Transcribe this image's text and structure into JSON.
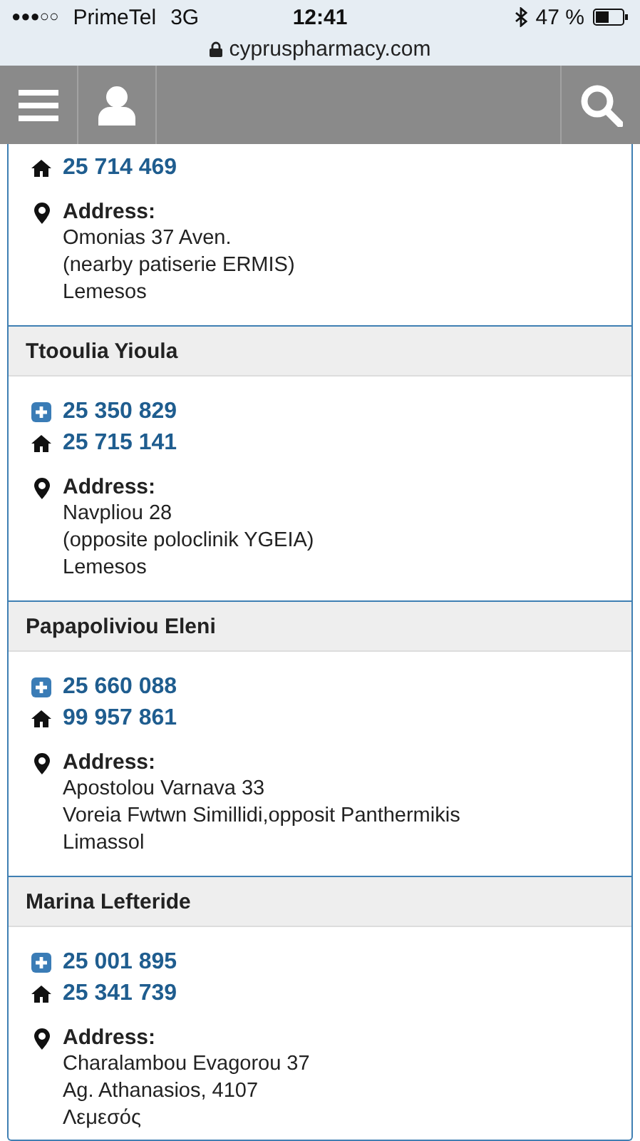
{
  "status_bar": {
    "signal": "●●●○○",
    "carrier": "PrimeTel",
    "network": "3G",
    "time": "12:41",
    "battery": "47 %"
  },
  "address_bar": {
    "url": "cypruspharmacy.com"
  },
  "pharmacies": [
    {
      "phones": [
        {
          "kind": "home",
          "number": "25 714 469"
        }
      ],
      "address_label": "Address:",
      "address_lines": [
        "Omonias 37 Aven.",
        "(nearby patiserie ERMIS)",
        "Lemesos"
      ]
    },
    {
      "name": "Ttooulia Yioula",
      "phones": [
        {
          "kind": "pharmacy",
          "number": "25 350 829"
        },
        {
          "kind": "home",
          "number": "25 715 141"
        }
      ],
      "address_label": "Address:",
      "address_lines": [
        "Navpliou 28",
        "(opposite poloclinik YGEIA)",
        "Lemesos"
      ]
    },
    {
      "name": "Papapoliviou Eleni",
      "phones": [
        {
          "kind": "pharmacy",
          "number": "25 660 088"
        },
        {
          "kind": "home",
          "number": "99 957 861"
        }
      ],
      "address_label": "Address:",
      "address_lines": [
        "Apostolou Varnava 33",
        "Voreia Fwtwn Simillidi,opposit Panthermikis",
        "Limassol"
      ]
    },
    {
      "name": "Marina Lefteride",
      "phones": [
        {
          "kind": "pharmacy",
          "number": "25 001 895"
        },
        {
          "kind": "home",
          "number": "25 341 739"
        }
      ],
      "address_label": "Address:",
      "address_lines": [
        "Charalambou Evagorou 37",
        "Ag. Athanasios, 4107",
        "Λεμεσός"
      ]
    }
  ]
}
